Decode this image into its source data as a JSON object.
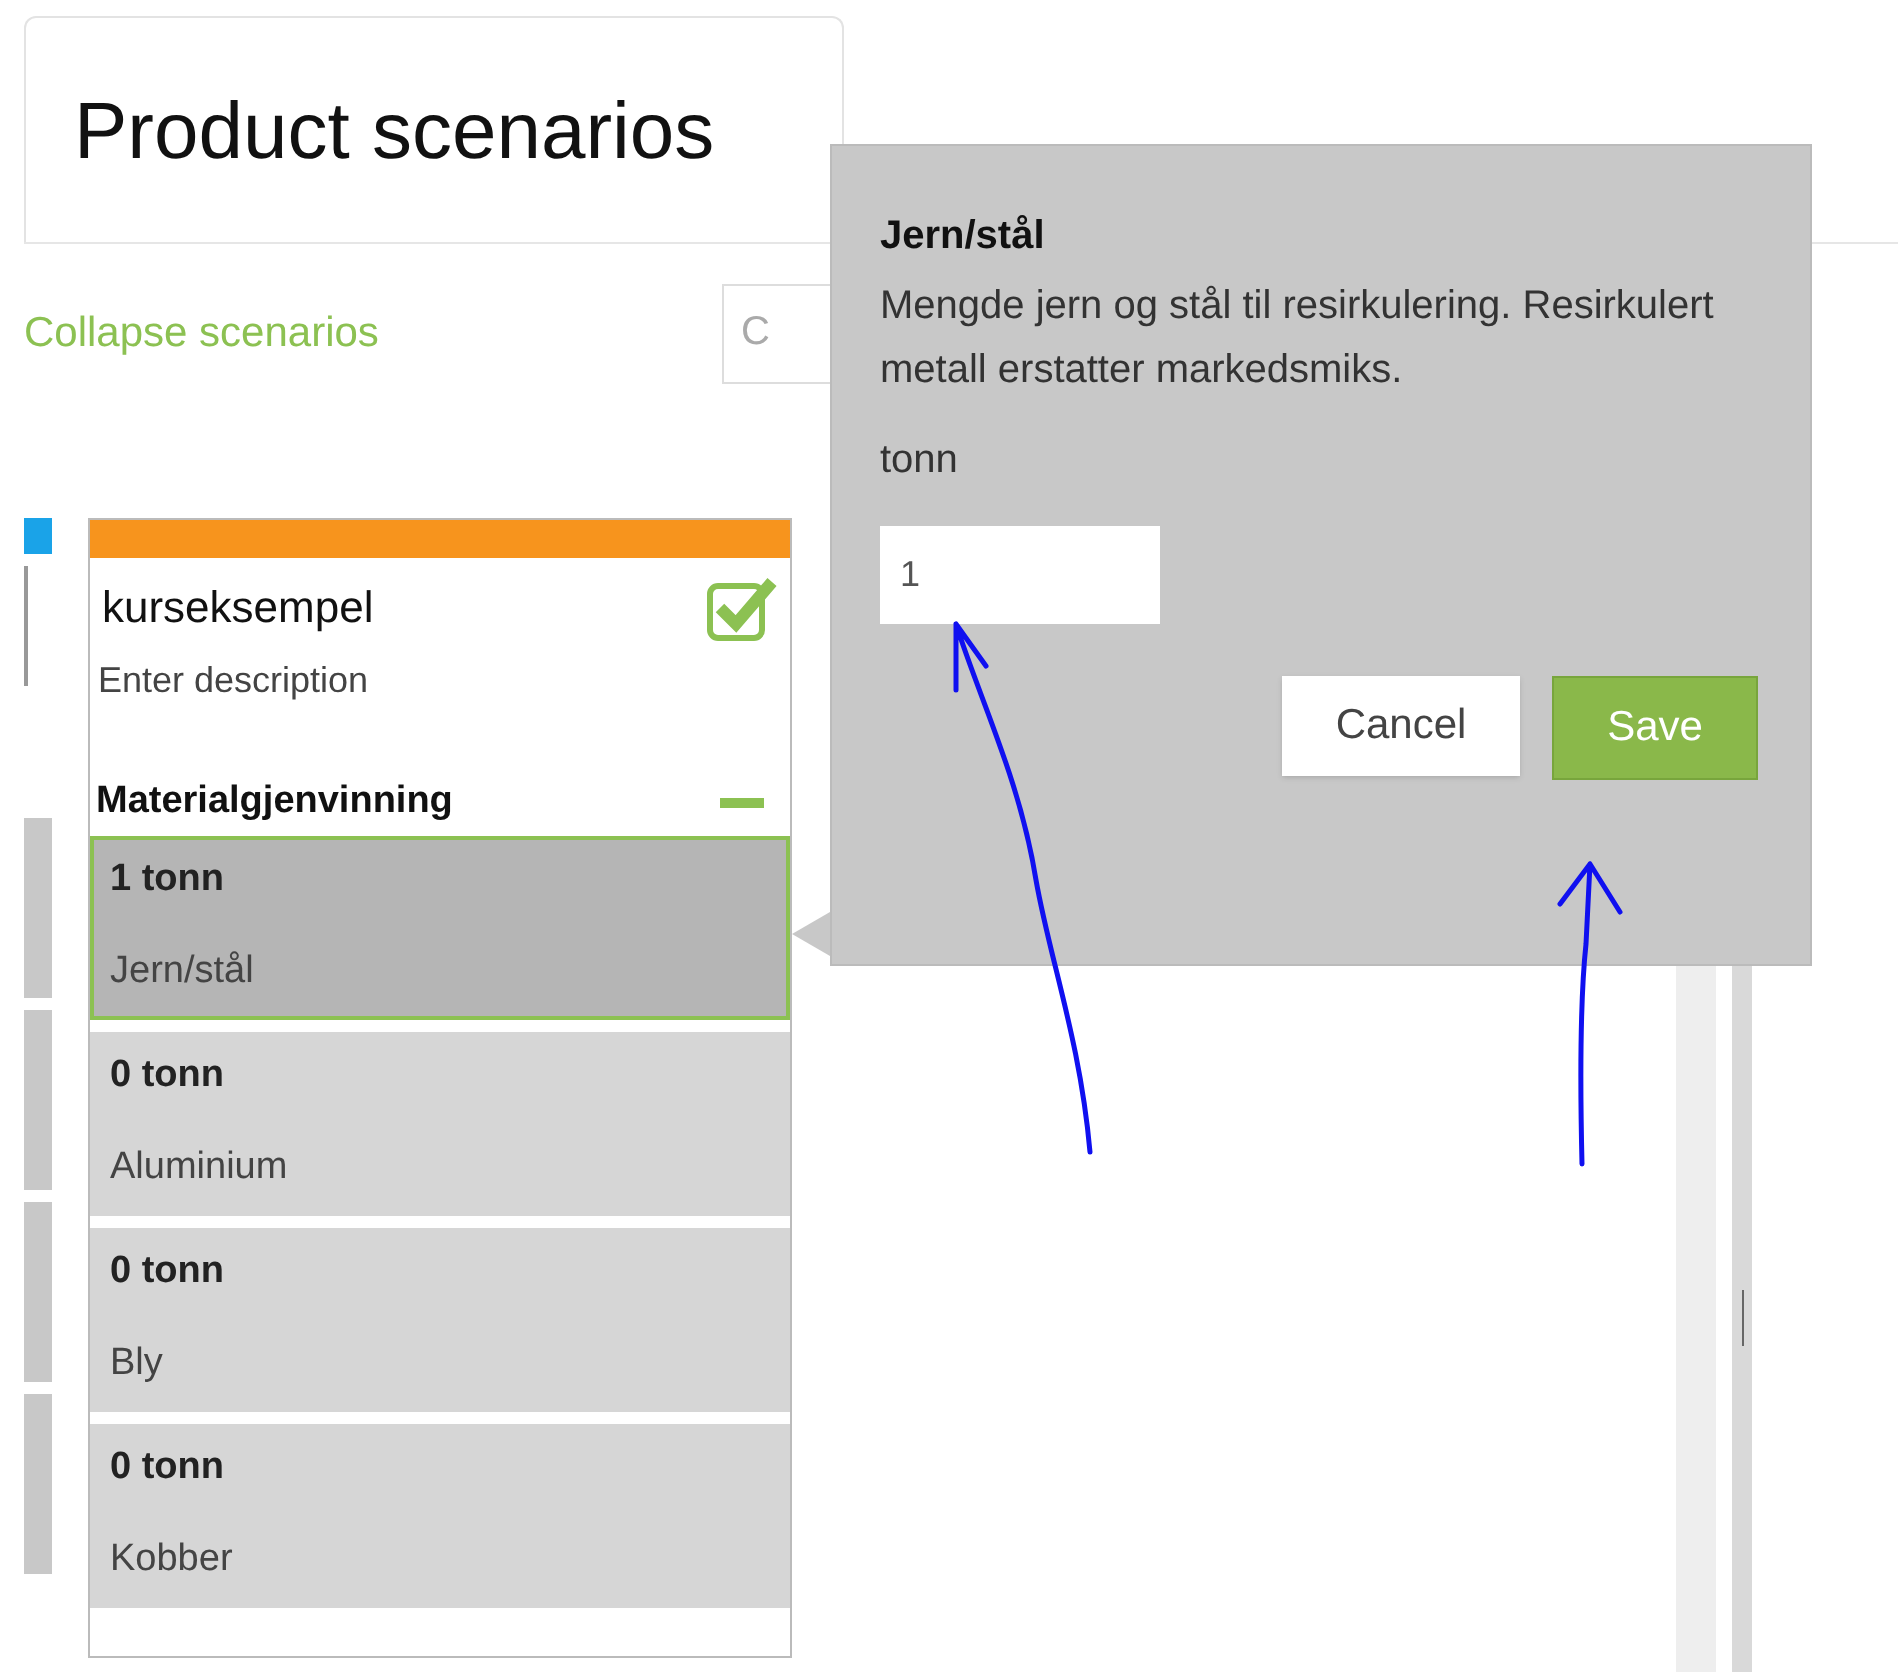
{
  "header": {
    "title": "Product scenarios"
  },
  "toolbar": {
    "collapse_link": "Collapse scenarios",
    "search": {
      "placeholder": "C"
    }
  },
  "scenario": {
    "name": "kurseksempel",
    "checked": true,
    "description_placeholder": "Enter description",
    "section": {
      "title": "Materialgjenvinning",
      "expanded": true,
      "items": [
        {
          "amount": "1 tonn",
          "label": "Jern/stål",
          "selected": true
        },
        {
          "amount": "0 tonn",
          "label": "Aluminium",
          "selected": false
        },
        {
          "amount": "0 tonn",
          "label": "Bly",
          "selected": false
        },
        {
          "amount": "0 tonn",
          "label": "Kobber",
          "selected": false
        }
      ]
    }
  },
  "popover": {
    "title": "Jern/stål",
    "description": "Mengde jern og stål til resirkulering. Resirkulert metall erstatter markedsmiks.",
    "unit": "tonn",
    "value": "1",
    "buttons": [
      {
        "label": "Cancel",
        "kind": "secondary"
      },
      {
        "label": "Save",
        "kind": "primary"
      }
    ]
  }
}
